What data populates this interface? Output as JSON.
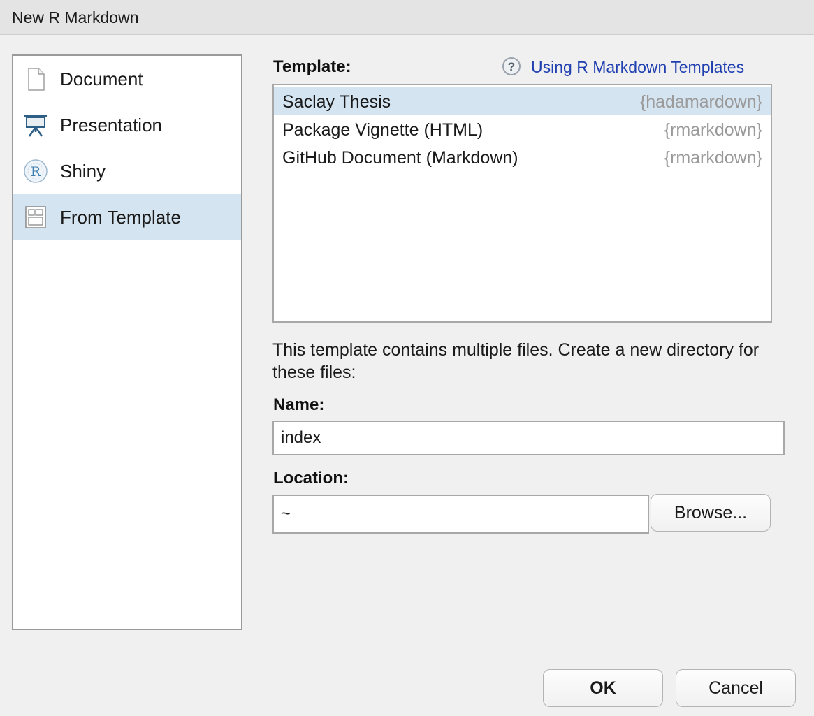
{
  "window": {
    "title": "New R Markdown"
  },
  "sidebar": {
    "items": [
      {
        "label": "Document",
        "icon": "document-icon"
      },
      {
        "label": "Presentation",
        "icon": "presentation-icon"
      },
      {
        "label": "Shiny",
        "icon": "shiny-icon"
      },
      {
        "label": "From Template",
        "icon": "template-icon",
        "selected": true
      }
    ]
  },
  "template": {
    "label": "Template:",
    "help_link": "Using R Markdown Templates",
    "items": [
      {
        "name": "Saclay Thesis",
        "package": "{hadamardown}",
        "selected": true
      },
      {
        "name": "Package Vignette (HTML)",
        "package": "{rmarkdown}"
      },
      {
        "name": "GitHub Document (Markdown)",
        "package": "{rmarkdown}"
      }
    ]
  },
  "description": "This template contains multiple files. Create a new directory for these files:",
  "name_field": {
    "label": "Name:",
    "value": "index"
  },
  "location_field": {
    "label": "Location:",
    "value": "~",
    "browse_label": "Browse..."
  },
  "buttons": {
    "ok": "OK",
    "cancel": "Cancel"
  },
  "colors": {
    "selection": "#d5e4f1",
    "link": "#1f3fb0"
  }
}
